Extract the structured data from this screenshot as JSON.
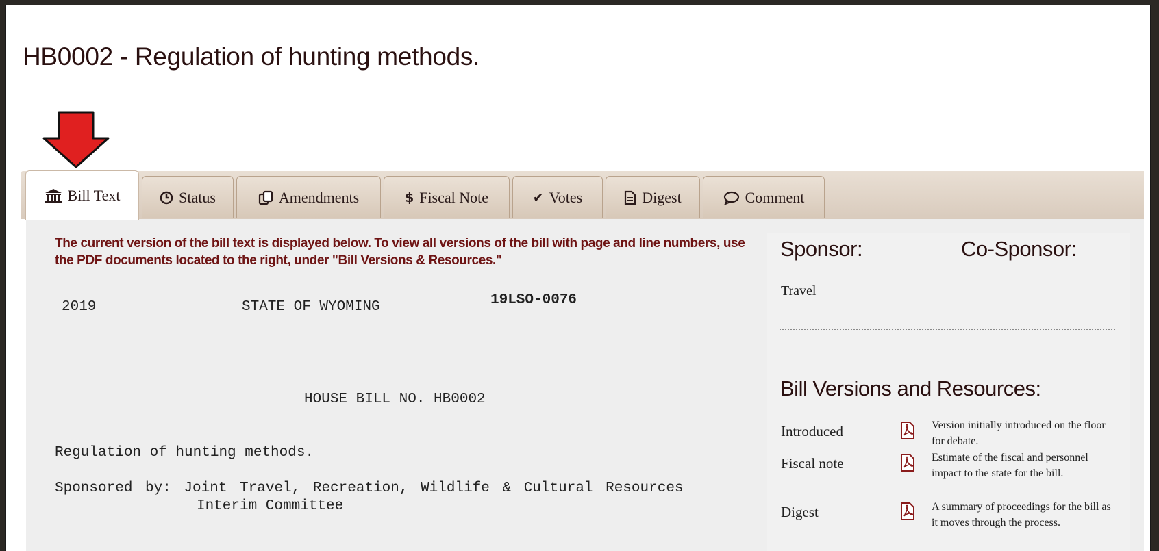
{
  "page": {
    "title": "HB0002 - Regulation of hunting methods."
  },
  "tabs": [
    {
      "label": "Bill Text",
      "icon": "bank-icon",
      "active": true
    },
    {
      "label": "Status",
      "icon": "clock-icon"
    },
    {
      "label": "Amendments",
      "icon": "copy-icon"
    },
    {
      "label": "Fiscal Note",
      "icon": "dollar-icon"
    },
    {
      "label": "Votes",
      "icon": "check-icon"
    },
    {
      "label": "Digest",
      "icon": "document-icon"
    },
    {
      "label": "Comment",
      "icon": "speech-bubble-icon"
    }
  ],
  "notice": "The current version of the bill text is displayed below. To view all versions of the bill with page and line numbers, use the PDF documents located to the right, under \"Bill Versions & Resources.\"",
  "bill": {
    "year": "2019",
    "state": "STATE OF WYOMING",
    "code": "19LSO-0076",
    "house_bill": "HOUSE BILL NO. HB0002",
    "subject": "Regulation of hunting methods.",
    "sponsored_line1": "Sponsored by: Joint Travel, Recreation, Wildlife & Cultural Resources",
    "sponsored_line2": "Interim Committee"
  },
  "sidebar": {
    "sponsor_heading": "Sponsor:",
    "cosponsor_heading": "Co-Sponsor:",
    "sponsor_value": "Travel",
    "resources_heading": "Bill Versions and Resources:",
    "resources": [
      {
        "label": "Introduced",
        "description": "Version initially introduced on the floor for debate."
      },
      {
        "label": "Fiscal note",
        "description": "Estimate of the fiscal and personnel impact to the state for the bill."
      },
      {
        "label": "Digest",
        "description": "A summary of proceedings for the bill as it moves through the process."
      }
    ]
  },
  "colors": {
    "accent_red": "#e02020",
    "heading_maroon": "#6e1414",
    "tab_tan": "#d9cbbd"
  }
}
